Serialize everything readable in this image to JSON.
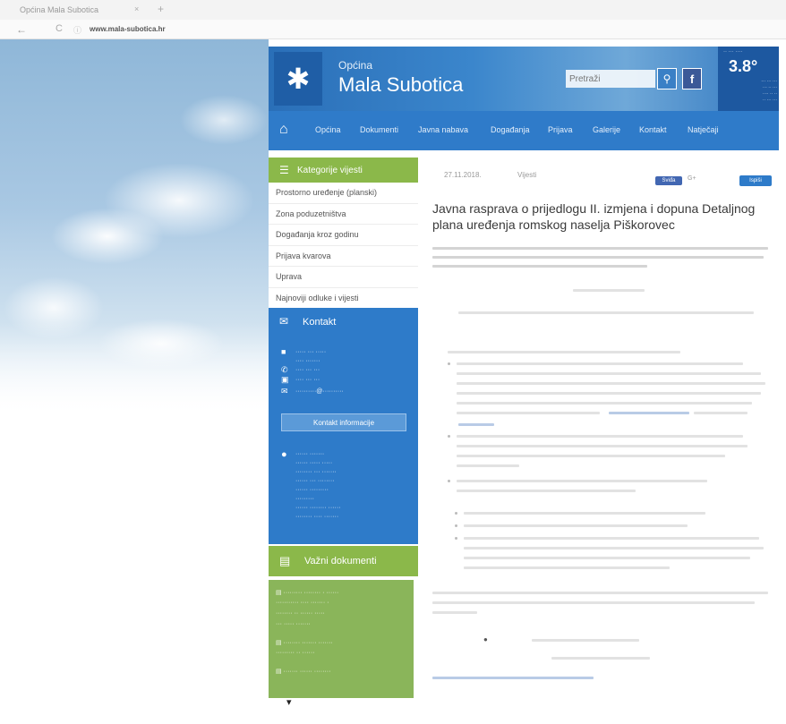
{
  "browser": {
    "tab_title": "Općina Mala Subotica",
    "tab_close": "×",
    "new_tab": "+",
    "back": "←",
    "reload": "C",
    "info": "ⓘ",
    "url_domain": "www.mala-subotica.hr"
  },
  "header": {
    "municipality_label": "Općina",
    "site_name": "Mala Subotica",
    "logo_glyph": "✱",
    "search_placeholder": "Pretraži",
    "search_icon": "⚲",
    "facebook_letter": "f",
    "weather": {
      "temperature": "3.8°"
    }
  },
  "nav": {
    "home_icon": "⌂",
    "items": [
      "Općina",
      "Dokumenti",
      "Javna nabava",
      "Događanja",
      "Prijava",
      "Galerije",
      "Kontakt",
      "Natječaji"
    ]
  },
  "sidebar": {
    "categories_title": "Kategorije vijesti",
    "categories_icon": "☰",
    "categories": [
      "Prostorno uređenje (planski)",
      "Zona poduzetništva",
      "Događanja kroz godinu",
      "Prijava kvarova",
      "Uprava",
      "Najnoviji odluke i vijesti"
    ],
    "contact": {
      "title": "Kontakt",
      "icon": "✉",
      "contact_info_button": "Kontakt informacije"
    },
    "documents": {
      "title": "Važni dokumenti",
      "icon": "▤"
    }
  },
  "article": {
    "date": "27.11.2018.",
    "category": "Vijesti",
    "like_label": "Sviđa",
    "gplus_label": "G+",
    "print_label": "Ispiši",
    "title": "Javna rasprava o prijedlogu II. izmjena i dopuna Detaljnog plana uređenja romskog naselja Piškorovec",
    "attachment_icon": "●"
  },
  "colors": {
    "header_blue": "#2a6fb8",
    "nav_blue": "#2f7bc9",
    "sidebar_green": "#8bb84a",
    "link_blue": "#2c62ad"
  }
}
